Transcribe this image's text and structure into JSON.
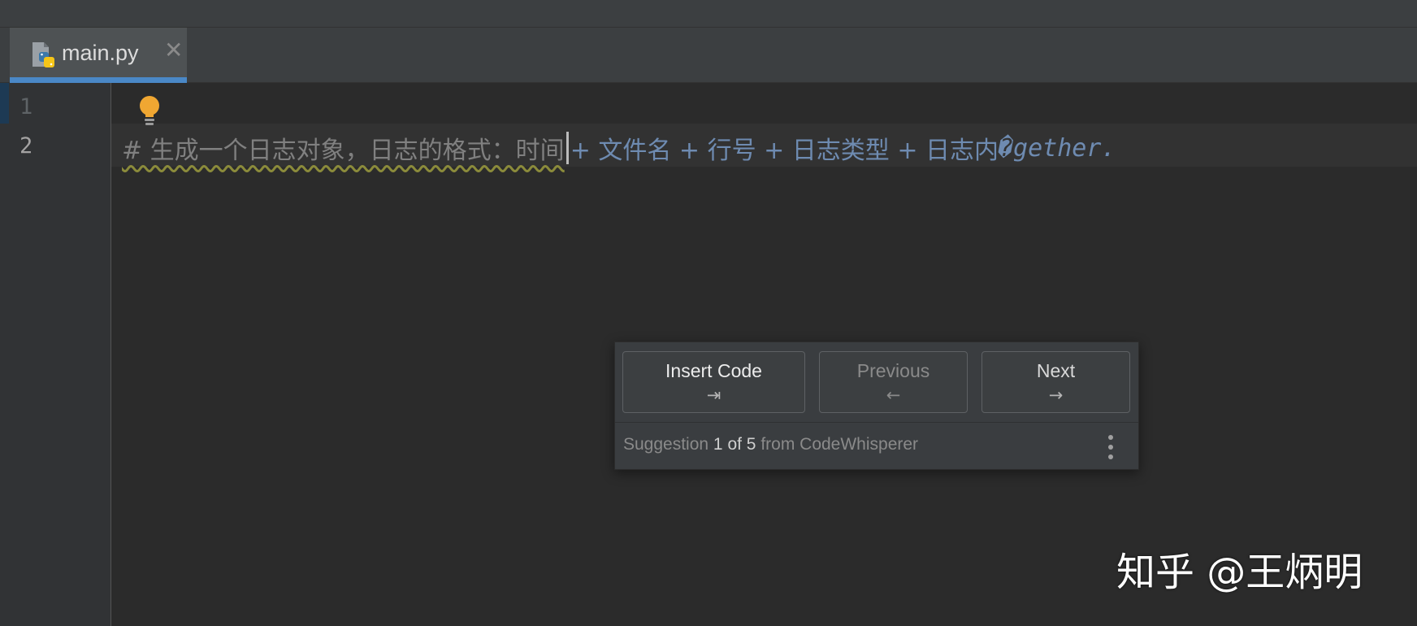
{
  "tab": {
    "label": "main.py",
    "close": "✕"
  },
  "editor": {
    "line_numbers": [
      "1",
      "2"
    ],
    "comment_text": "#  生成一个日志对象，日志的格式：时间 ",
    "ghost_text": "+ 文件名 + 行号 + 日志类型 + 日志内",
    "ghost_tail": "�gether."
  },
  "popup": {
    "insert": {
      "label": "Insert Code",
      "key": "⇥"
    },
    "previous": {
      "label": "Previous",
      "key": "←"
    },
    "next": {
      "label": "Next",
      "key": "→"
    },
    "status": {
      "prefix": "Suggestion ",
      "current": "1",
      "of_word": " of ",
      "total": "5",
      "suffix": " from CodeWhisperer"
    }
  },
  "watermark": "知乎 @王炳明",
  "colors": {
    "accent": "#4a88c7",
    "bulb": "#f0a732",
    "ghost_text": "#6e8bb1",
    "comment": "#808080"
  }
}
